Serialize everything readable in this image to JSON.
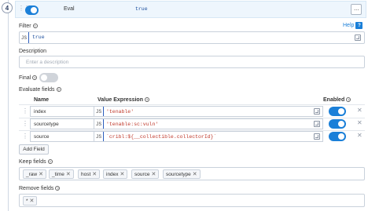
{
  "step": {
    "number": "4"
  },
  "header": {
    "function_name": "Eval",
    "filter_preview": "true",
    "menu_label": "···"
  },
  "filter": {
    "label": "Filter",
    "help_label": "Help",
    "lang_tag": "JS",
    "value": "true"
  },
  "description": {
    "label": "Description",
    "placeholder": "Enter a description"
  },
  "final": {
    "label": "Final"
  },
  "evaluate_fields": {
    "label": "Evaluate fields",
    "columns": {
      "name": "Name",
      "value": "Value Expression",
      "enabled": "Enabled"
    },
    "rows": [
      {
        "name": "index",
        "lang": "JS",
        "expression": "'tenable'",
        "enabled": true
      },
      {
        "name": "sourcetype",
        "lang": "JS",
        "expression": "'tenable:sc:vuln'",
        "enabled": true
      },
      {
        "name": "source",
        "lang": "JS",
        "expression": "`cribl:${__collectible.collectorId}`",
        "enabled": true
      }
    ],
    "add_button": "Add Field"
  },
  "keep_fields": {
    "label": "Keep fields",
    "chips": [
      "_raw",
      "_time",
      "host",
      "index",
      "source",
      "sourcetype"
    ]
  },
  "remove_fields": {
    "label": "Remove fields",
    "chips": [
      "*"
    ]
  },
  "colors": {
    "accent": "#1a7fd8",
    "header_bg": "#eef6fd",
    "string_red": "#c0392b"
  }
}
